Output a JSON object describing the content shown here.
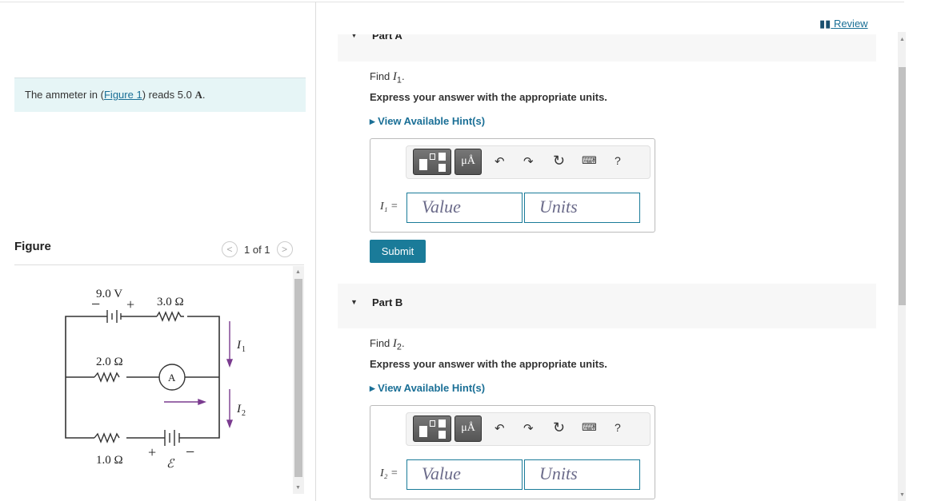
{
  "problem": {
    "text_before": "The ammeter in (",
    "link": "Figure 1",
    "text_after": ") reads 5.0 ",
    "unit": "A",
    "end": "."
  },
  "figure": {
    "title": "Figure",
    "pager": "1 of 1",
    "labels": {
      "battery_top": "9.0 V",
      "r_top": "3.0 Ω",
      "r_mid": "2.0 Ω",
      "ammeter": "A",
      "r_bot": "1.0 Ω",
      "emf": "ℰ",
      "i1": "I",
      "i1_sub": "1",
      "i2": "I",
      "i2_sub": "2",
      "plus": "+",
      "minus": "−"
    }
  },
  "review": "Review",
  "parts": [
    {
      "title": "Part A",
      "find": "Find ",
      "var": "I",
      "sub": "1",
      "express": "Express your answer with the appropriate units.",
      "hint": "View Available Hint(s)",
      "label": "I₁ =",
      "value_ph": "Value",
      "units_ph": "Units",
      "submit": "Submit"
    },
    {
      "title": "Part B",
      "find": "Find ",
      "var": "I",
      "sub": "2",
      "express": "Express your answer with the appropriate units.",
      "hint": "View Available Hint(s)",
      "label": "I₂ =",
      "value_ph": "Value",
      "units_ph": "Units"
    }
  ],
  "toolbar": {
    "units_btn": "μÅ",
    "help": "?"
  }
}
